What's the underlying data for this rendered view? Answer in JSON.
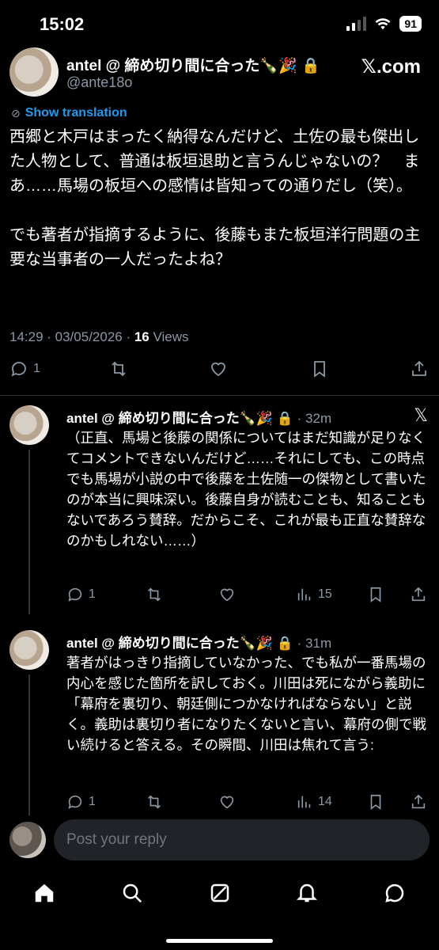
{
  "status": {
    "time": "15:02",
    "battery": "91"
  },
  "main_tweet": {
    "author_name": "antel @ 締め切り間に合った🍾🎉 🔒",
    "handle": "@ante18o",
    "platform": "𝕏.com",
    "translate_label": "Show translation",
    "text": "西郷と木戸はまったく納得なんだけど、土佐の最も傑出した人物として、普通は板垣退助と言うんじゃないの？　まあ……馬場の板垣への感情は皆知っての通りだし（笑）。\n\nでも著者が指摘するように、後藤もまた板垣洋行問題の主要な当事者の一人だったよね？",
    "timestamp": "14:29 · 03/05/2026 · ",
    "views_count": "16",
    "views_label": " Views",
    "replies": "1"
  },
  "replies": [
    {
      "author_name": "antel @ 締め切り間に合った🍾🎉 🔒",
      "time": "· 32m",
      "text": "（正直、馬場と後藤の関係についてはまだ知識が足りなくてコメントできないんだけど……それにしても、この時点でも馬場が小説の中で後藤を土佐随一の傑物として書いたのが本当に興味深い。後藤自身が読むことも、知ることもないであろう賛辞。だからこそ、これが最も正直な賛辞なのかもしれない……）",
      "replies": "1",
      "views": "15"
    },
    {
      "author_name": "antel @ 締め切り間に合った🍾🎉 🔒",
      "time": "· 31m",
      "text": "著者がはっきり指摘していなかった、でも私が一番馬場の内心を感じた箇所を訳しておく。川田は死にながら義助に「幕府を裏切り、朝廷側につかなければならない」と説く。義助は裏切り者になりたくないと言い、幕府の側で戦い続けると答える。その瞬間、川田は焦れて言う:",
      "replies": "1",
      "views": "14"
    }
  ],
  "composer": {
    "placeholder": "Post your reply"
  },
  "icons": {
    "reply": "reply-icon",
    "repost": "repost-icon",
    "like": "like-icon",
    "bookmark": "bookmark-icon",
    "share": "share-icon",
    "views": "views-icon",
    "home": "home-icon",
    "search": "search-icon",
    "grok": "grok-icon",
    "notifications": "bell-icon",
    "messages": "messages-icon"
  },
  "colors": {
    "accent": "#1d9bf0",
    "muted": "#8b98a5",
    "background": "#000000"
  }
}
